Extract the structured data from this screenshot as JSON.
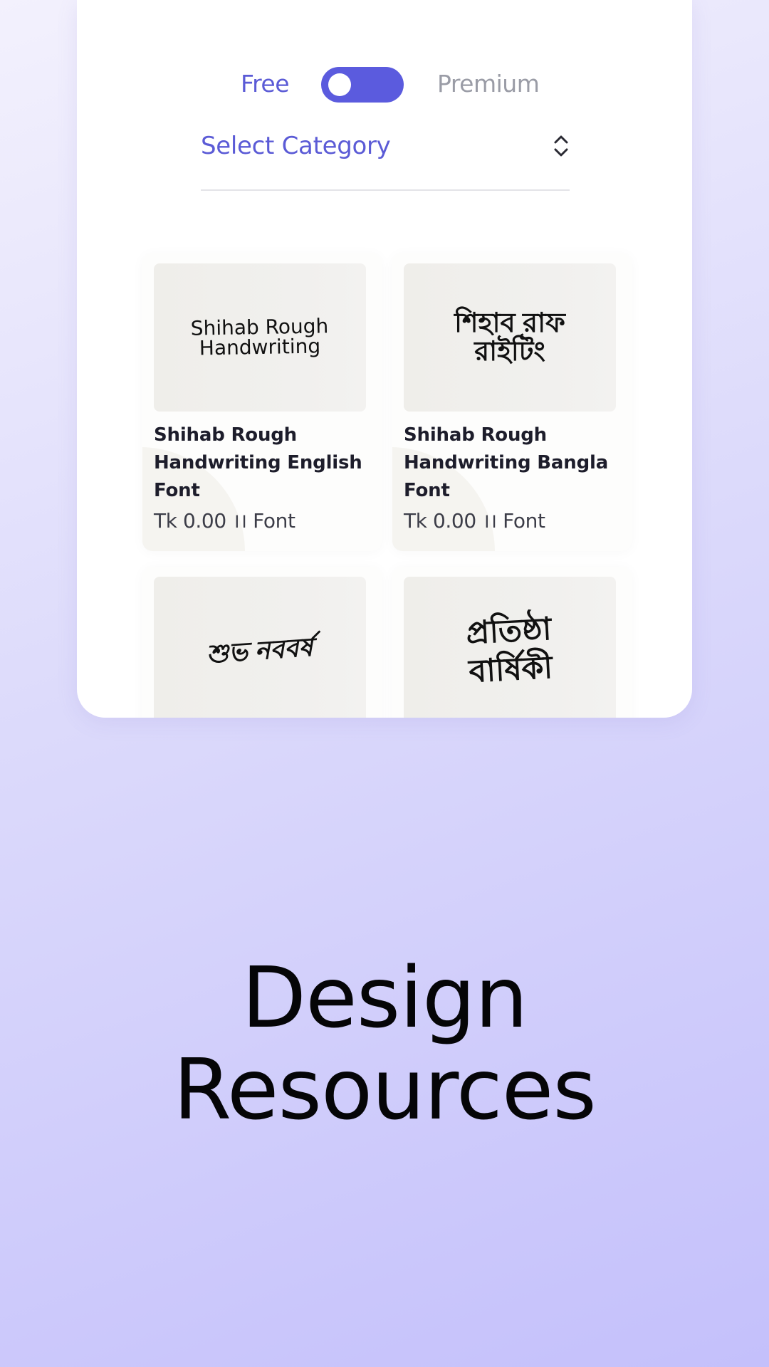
{
  "toggle": {
    "free_label": "Free",
    "premium_label": "Premium",
    "state": "free",
    "accent_color": "#5b5bde"
  },
  "category_select": {
    "label": "Select Category",
    "icon": "chevron-up-down-icon"
  },
  "fonts": [
    {
      "preview": "Shihab Rough\nHandwriting",
      "title": "Shihab Rough Handwriting English Font",
      "price": "Tk 0.00 ।। Font"
    },
    {
      "preview": "শিহাব রাফ\nরাইটিং",
      "title": "Shihab Rough Handwriting Bangla Font",
      "price": "Tk 0.00 ।। Font"
    },
    {
      "preview": "শুভ নববর্ষ",
      "title": "",
      "price": ""
    },
    {
      "preview": "প্রতিষ্ঠা\nবার্ষিকী",
      "title": "",
      "price": ""
    }
  ],
  "headline": {
    "line1": "Design",
    "line2": "Resources"
  }
}
